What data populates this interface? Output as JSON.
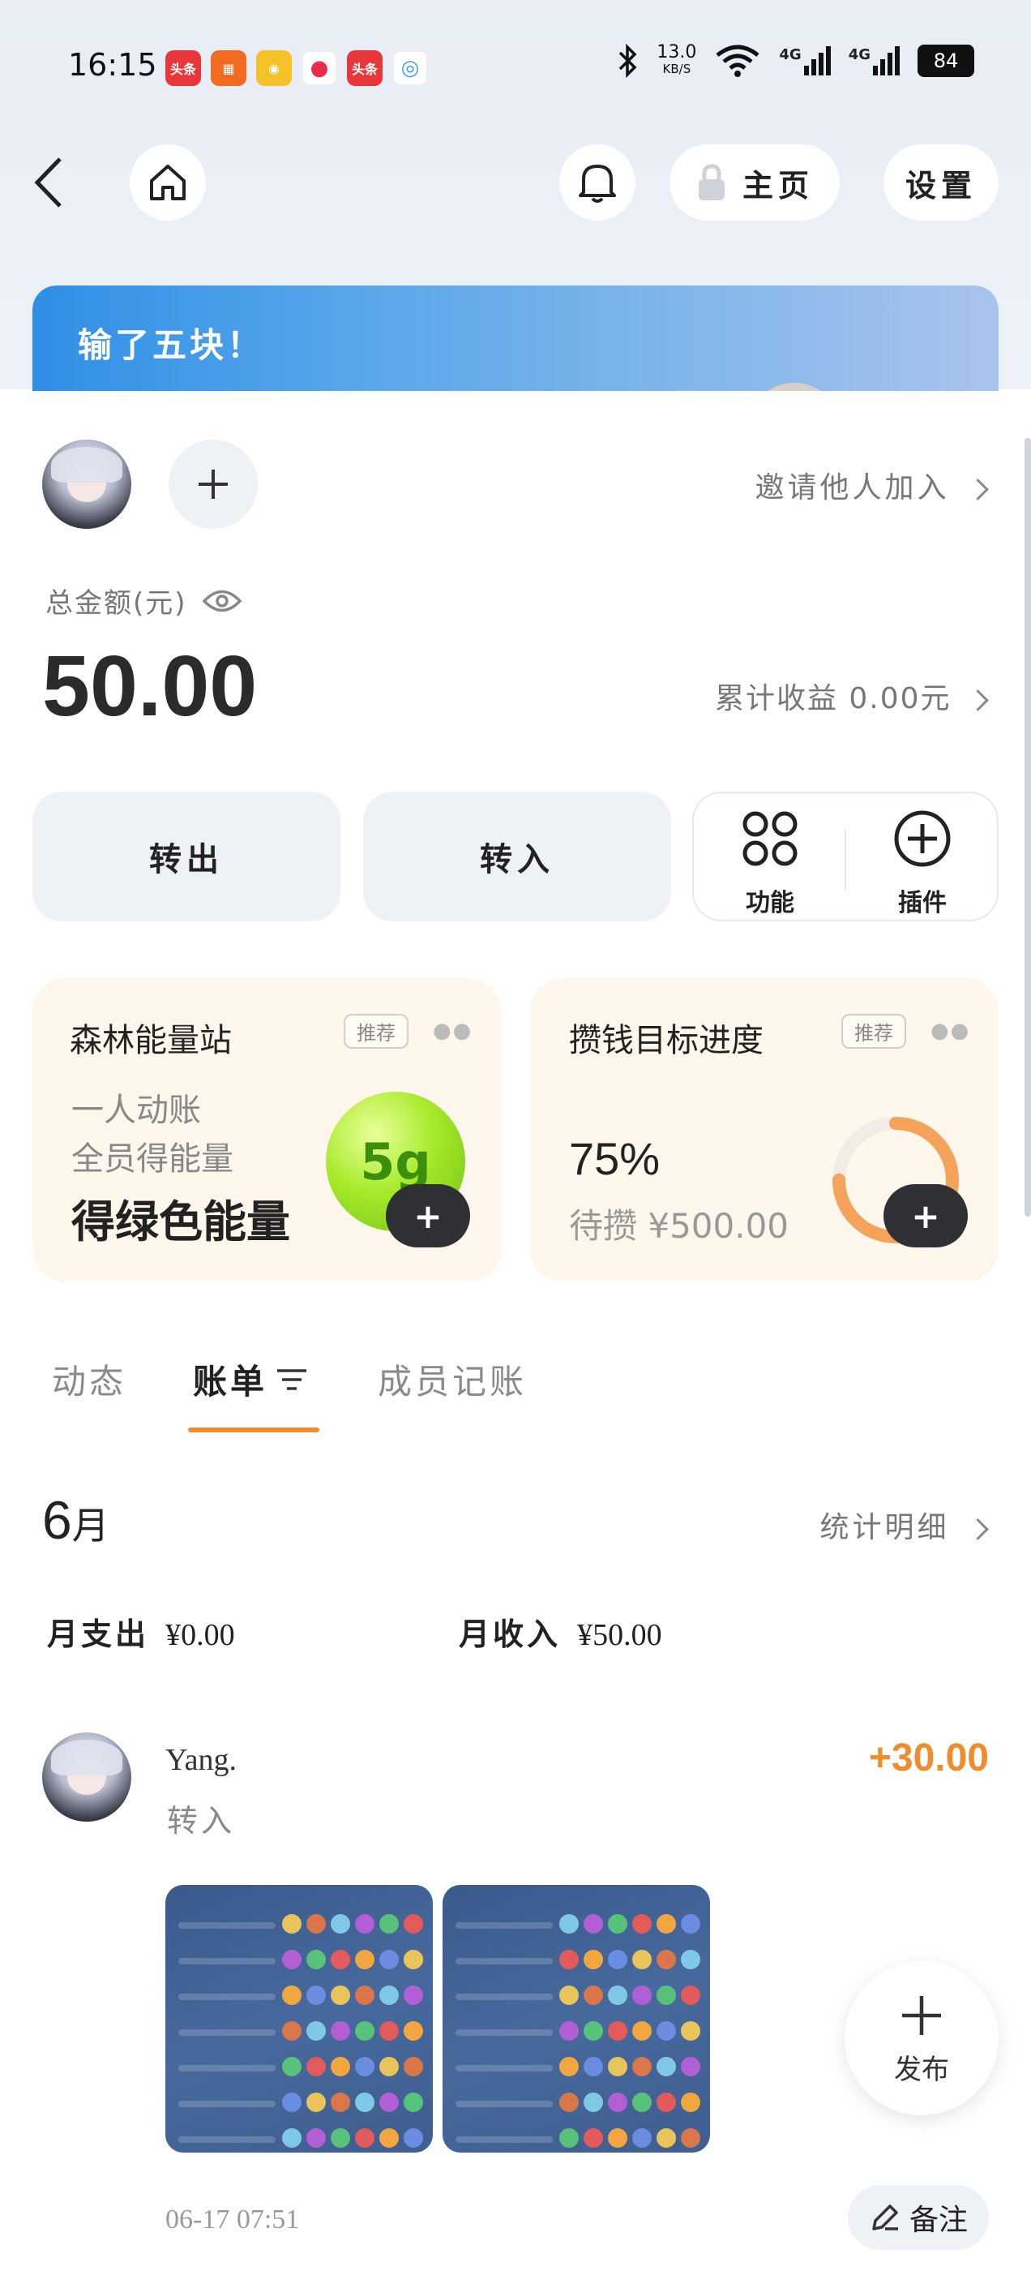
{
  "status_bar": {
    "time": "16:15",
    "net_speed_value": "13.0",
    "net_speed_unit": "KB/S",
    "signal_1": "4G",
    "signal_2": "4G",
    "battery": "84",
    "app_icons": [
      {
        "name": "toutiao-icon",
        "label": "头条",
        "color": "#e8363b"
      },
      {
        "name": "kuaishou-icon",
        "label": "",
        "color": "#f36b21"
      },
      {
        "name": "weibo-icon",
        "label": "",
        "color": "#f4c226"
      },
      {
        "name": "video-icon",
        "label": "",
        "color": "#ee2a4a"
      },
      {
        "name": "toutiao-lite-icon",
        "label": "头条",
        "color": "#e8363b"
      },
      {
        "name": "chat-icon",
        "label": "",
        "color": "#3aa0f0"
      }
    ]
  },
  "header": {
    "home_label": "主页",
    "settings_label": "设置"
  },
  "banner": {
    "text": "输了五块！"
  },
  "account": {
    "invite_label": "邀请他人加入",
    "total_label": "总金额(元)",
    "total_amount": "50.00",
    "cumulative_label": "累计收益 0.00元"
  },
  "actions": {
    "transfer_out": "转出",
    "transfer_in": "转入",
    "functions": "功能",
    "plugins": "插件"
  },
  "cards": {
    "forest": {
      "title": "森林能量站",
      "tag": "推荐",
      "line1": "一人动账",
      "line2": "全员得能量",
      "highlight": "得绿色能量",
      "energy": "5g"
    },
    "saving": {
      "title": "攒钱目标进度",
      "tag": "推荐",
      "percent": "75%",
      "progress": 0.75,
      "pending": "待攒 ¥500.00"
    }
  },
  "tabs": {
    "dynamic": "动态",
    "bills": "账单",
    "member": "成员记账"
  },
  "month": {
    "num": "6",
    "unit": "月",
    "stats_label": "统计明细",
    "expense_label": "月支出",
    "expense_value": "¥0.00",
    "income_label": "月收入",
    "income_value": "¥50.00"
  },
  "transaction": {
    "user": "Yang.",
    "type": "转入",
    "amount": "+30.00",
    "time": "06-17 07:51",
    "note_label": "备注"
  },
  "fab": {
    "label": "发布"
  },
  "colors": {
    "accent": "#f08c2b",
    "progress": "#f5a35a"
  }
}
